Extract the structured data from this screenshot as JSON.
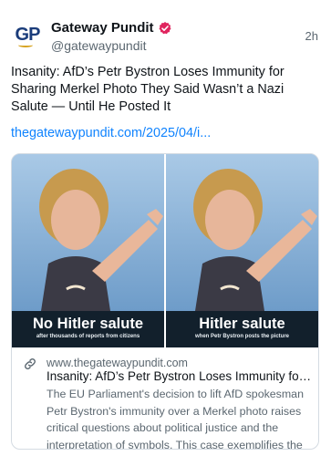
{
  "author": {
    "display_name": "Gateway Pundit",
    "handle": "@gatewaypundit",
    "avatar_text": "GP",
    "verified_icon": "verified-badge-icon"
  },
  "post": {
    "time": "2h",
    "text": "Insanity: AfD’s Petr Bystron Loses Immunity for Sharing Merkel Photo They Said Wasn’t a Nazi Salute — Until He Posted It",
    "link_text": "thegatewaypundit.com/2025/04/i..."
  },
  "card": {
    "image": {
      "left_caption_main": "No Hitler salute",
      "left_caption_sub": "after thousands of reports from citizens",
      "right_caption_main": "Hitler salute",
      "right_caption_sub": "when Petr Bystron posts the picture"
    },
    "domain": "www.thegatewaypundit.com",
    "title": "Insanity: AfD’s Petr Bystron Loses Immunity for Sharing Merkel Photo They Said Wasn’t a Nazi Salute — Until He Posted It",
    "description": "The EU Parliament's decision to lift AfD spokesman Petr Bystron's immunity over a Merkel photo raises critical questions about political justice and the interpretation of symbols. This case exemplifies the complexities of ..."
  },
  "colors": {
    "link": "#1083fe",
    "verified": "#e0245e",
    "caption_bg": "#12202c"
  }
}
